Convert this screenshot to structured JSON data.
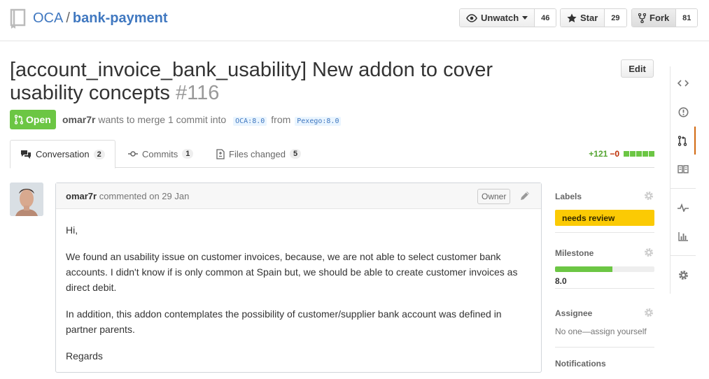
{
  "repo": {
    "owner": "OCA",
    "separator": "/",
    "name": "bank-payment",
    "watch_label": "Unwatch",
    "watch_count": "46",
    "star_label": "Star",
    "star_count": "29",
    "fork_label": "Fork",
    "fork_count": "81"
  },
  "pr": {
    "title": "[account_invoice_bank_usability] New addon to cover usability concepts",
    "number": "#116",
    "edit_label": "Edit",
    "state": "Open",
    "author": "omar7r",
    "merge_text": "wants to merge 1 commit into",
    "base_branch": "OCA:8.0",
    "from_text": "from",
    "head_branch": "Pexego:8.0"
  },
  "tabs": [
    {
      "label": "Conversation",
      "count": "2",
      "icon": "comment-discussion-icon"
    },
    {
      "label": "Commits",
      "count": "1",
      "icon": "commit-icon"
    },
    {
      "label": "Files changed",
      "count": "5",
      "icon": "file-diff-icon"
    }
  ],
  "diffstat": {
    "additions": "+121",
    "deletions": "−0",
    "blocks": 5
  },
  "comment": {
    "author": "omar7r",
    "action": "commented on 29 Jan",
    "role": "Owner",
    "paragraphs": [
      "Hi,",
      "We found an usability issue on customer invoices, because, we are not able to select customer bank accounts. I didn't know if is only common at Spain but, we should be able to create customer invoices as direct debit.",
      "In addition, this addon contemplates the possibility of customer/supplier bank account was defined in partner parents.",
      "Regards"
    ]
  },
  "sidebar": {
    "labels_title": "Labels",
    "label": "needs review",
    "label_color": "#fbca04",
    "milestone_title": "Milestone",
    "milestone_progress": 0.58,
    "milestone_name": "8.0",
    "assignee_title": "Assignee",
    "assignee_text": "No one—assign yourself",
    "notifications_title": "Notifications"
  },
  "colors": {
    "link": "#4078c0",
    "open_state": "#6cc644",
    "nav_active": "#d26911"
  }
}
